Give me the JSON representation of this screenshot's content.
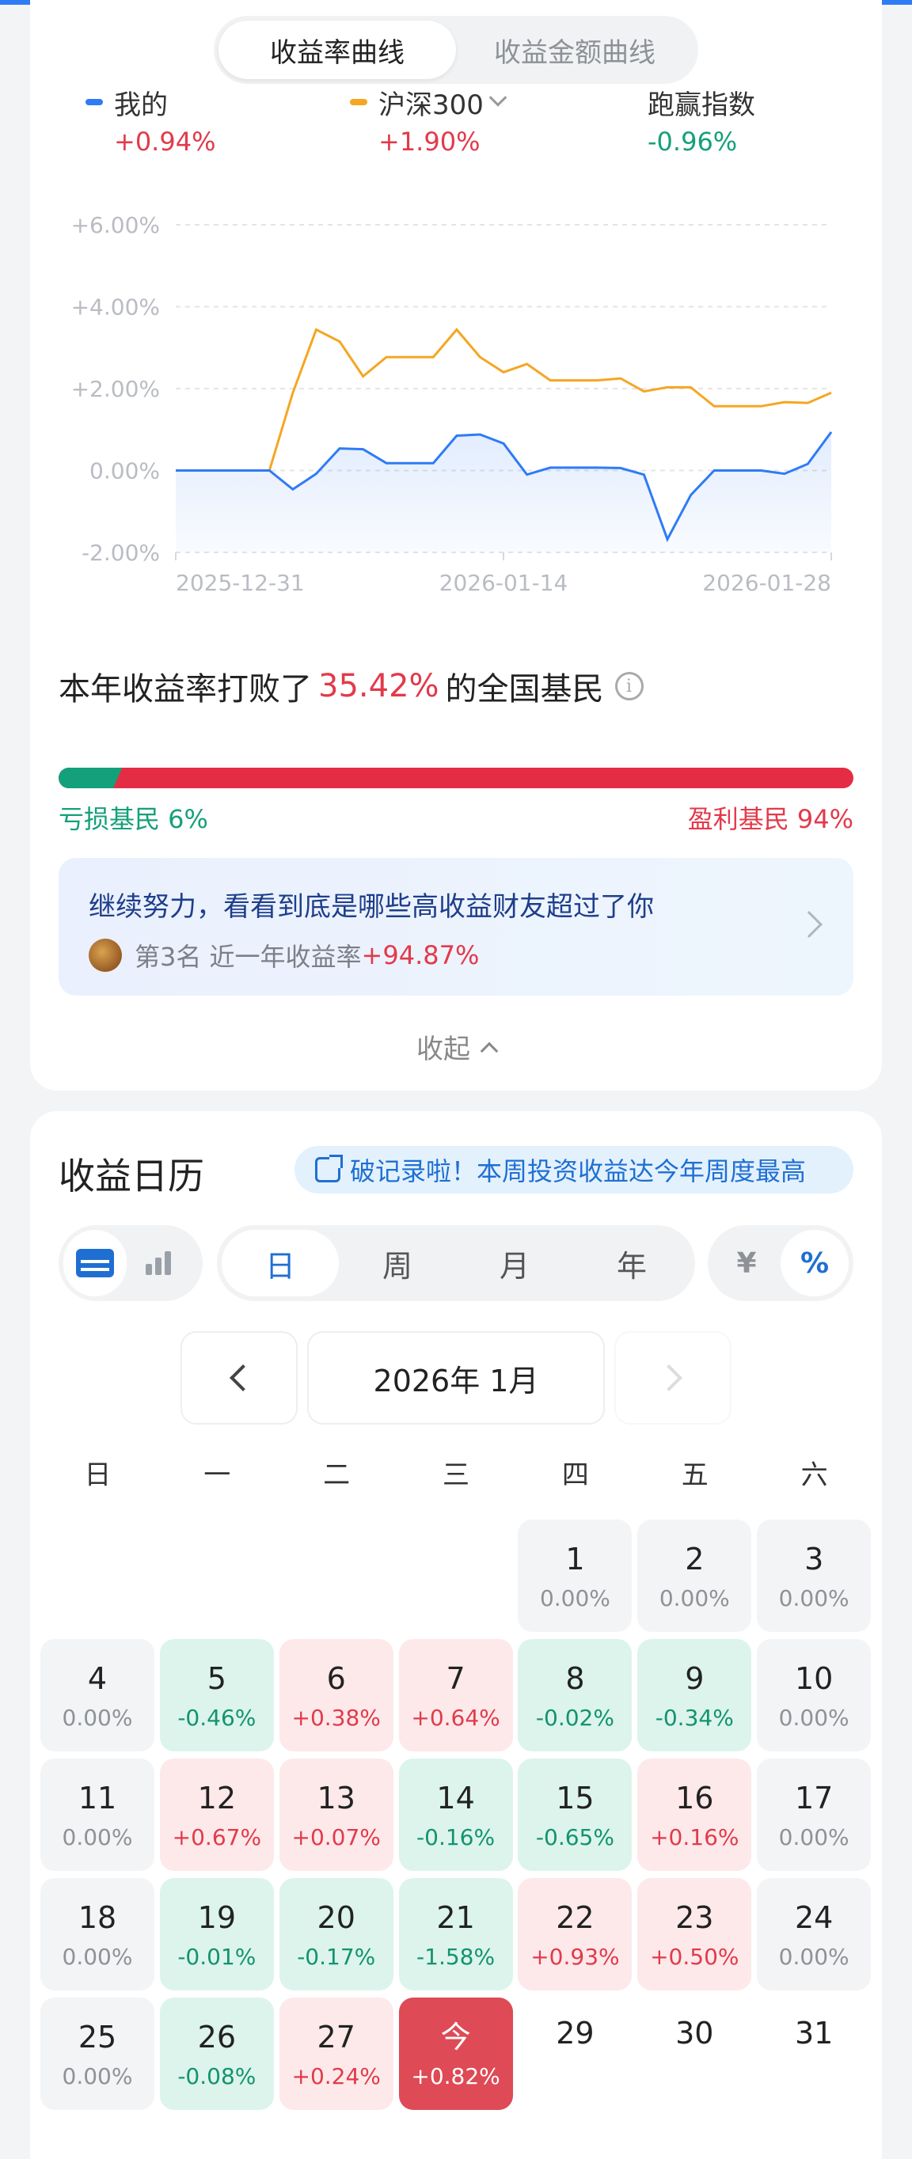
{
  "curve_tabs": [
    "收益率曲线",
    "收益金额曲线"
  ],
  "legend": [
    {
      "name": "我的",
      "value": "+0.94%",
      "color": "#2f7bf5",
      "value_color": "#e23a4b"
    },
    {
      "name": "沪深300",
      "value": "+1.90%",
      "color": "#f5a623",
      "value_color": "#e23a4b"
    },
    {
      "name": "跑赢指数",
      "value": "-0.96%",
      "color": "",
      "value_color": "#14a07a"
    }
  ],
  "chart_data": {
    "type": "line",
    "y_ticks": [
      "+6.00%",
      "+4.00%",
      "+2.00%",
      "0.00%",
      "-2.00%"
    ],
    "ylim": [
      -2,
      6
    ],
    "x_tick_labels": [
      "2025-12-31",
      "2026-01-14",
      "2026-01-28"
    ],
    "series": [
      {
        "name": "我的",
        "color": "#2f7bf5",
        "values": [
          0,
          0,
          0,
          0,
          0,
          -0.46,
          -0.08,
          0.54,
          0.52,
          0.18,
          0.18,
          0.18,
          0.85,
          0.88,
          0.66,
          -0.1,
          0.07,
          0.07,
          0.07,
          0.06,
          -0.1,
          -1.68,
          -0.6,
          0.0,
          0.0,
          0.0,
          -0.08,
          0.16,
          0.94
        ]
      },
      {
        "name": "沪深300",
        "color": "#f5a623",
        "values": [
          0,
          0,
          0,
          0,
          0,
          1.9,
          3.44,
          3.15,
          2.3,
          2.77,
          2.77,
          2.77,
          3.44,
          2.77,
          2.4,
          2.6,
          2.2,
          2.2,
          2.2,
          2.25,
          1.93,
          2.03,
          2.03,
          1.57,
          1.57,
          1.57,
          1.67,
          1.65,
          1.9
        ]
      }
    ]
  },
  "beat": {
    "prefix": "本年收益率打败了",
    "value": "35.42%",
    "suffix": "的全国基民"
  },
  "distribution": {
    "loss_label": "亏损基民 6%",
    "profit_label": "盈利基民 94%",
    "loss_fraction": 0.06
  },
  "promo": {
    "title": "继续努力，看看到底是哪些高收益财友超过了你",
    "rank": "第3名  近一年收益率",
    "rate": "+94.87%"
  },
  "collapse_label": "收起",
  "calendar": {
    "title": "收益日历",
    "record": "破记录啦！本周投资收益达今年周度最高",
    "periods": [
      "日",
      "周",
      "月",
      "年"
    ],
    "units": [
      "¥",
      "%"
    ],
    "month": "2026年 1月",
    "weekdays": [
      "日",
      "一",
      "二",
      "三",
      "四",
      "五",
      "六"
    ],
    "days": [
      {
        "d": "1",
        "v": "0.00%",
        "s": "neutral"
      },
      {
        "d": "2",
        "v": "0.00%",
        "s": "neutral"
      },
      {
        "d": "3",
        "v": "0.00%",
        "s": "neutral"
      },
      {
        "d": "4",
        "v": "0.00%",
        "s": "neutral"
      },
      {
        "d": "5",
        "v": "-0.46%",
        "s": "down"
      },
      {
        "d": "6",
        "v": "+0.38%",
        "s": "up"
      },
      {
        "d": "7",
        "v": "+0.64%",
        "s": "up"
      },
      {
        "d": "8",
        "v": "-0.02%",
        "s": "down"
      },
      {
        "d": "9",
        "v": "-0.34%",
        "s": "down"
      },
      {
        "d": "10",
        "v": "0.00%",
        "s": "neutral"
      },
      {
        "d": "11",
        "v": "0.00%",
        "s": "neutral"
      },
      {
        "d": "12",
        "v": "+0.67%",
        "s": "up"
      },
      {
        "d": "13",
        "v": "+0.07%",
        "s": "up"
      },
      {
        "d": "14",
        "v": "-0.16%",
        "s": "down"
      },
      {
        "d": "15",
        "v": "-0.65%",
        "s": "down"
      },
      {
        "d": "16",
        "v": "+0.16%",
        "s": "up"
      },
      {
        "d": "17",
        "v": "0.00%",
        "s": "neutral"
      },
      {
        "d": "18",
        "v": "0.00%",
        "s": "neutral"
      },
      {
        "d": "19",
        "v": "-0.01%",
        "s": "down"
      },
      {
        "d": "20",
        "v": "-0.17%",
        "s": "down"
      },
      {
        "d": "21",
        "v": "-1.58%",
        "s": "down"
      },
      {
        "d": "22",
        "v": "+0.93%",
        "s": "up"
      },
      {
        "d": "23",
        "v": "+0.50%",
        "s": "up"
      },
      {
        "d": "24",
        "v": "0.00%",
        "s": "neutral"
      },
      {
        "d": "25",
        "v": "0.00%",
        "s": "neutral"
      },
      {
        "d": "26",
        "v": "-0.08%",
        "s": "down"
      },
      {
        "d": "27",
        "v": "+0.24%",
        "s": "up"
      },
      {
        "d": "今",
        "v": "+0.82%",
        "s": "today"
      },
      {
        "d": "29",
        "v": "",
        "s": "future"
      },
      {
        "d": "30",
        "v": "",
        "s": "future"
      },
      {
        "d": "31",
        "v": "",
        "s": "future"
      }
    ]
  }
}
